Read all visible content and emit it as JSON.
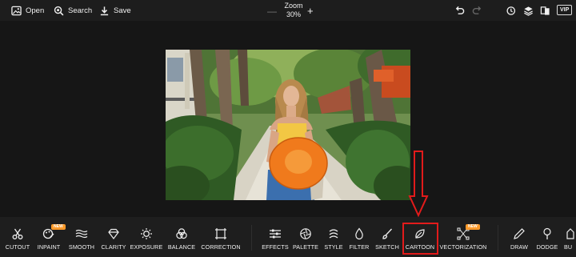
{
  "toolbar": {
    "open_label": "Open",
    "search_label": "Search",
    "save_label": "Save",
    "zoom_title": "Zoom",
    "zoom_value": "30%",
    "zoom_minus": "—",
    "zoom_plus": "+",
    "vip_label": "VIP",
    "icons": [
      "undo-icon",
      "redo-icon",
      "history-icon",
      "layers-icon",
      "compare-icon"
    ]
  },
  "tools_left": [
    {
      "label": "CUTOUT",
      "icon": "scissors-icon"
    },
    {
      "label": "INPAINT",
      "icon": "inpaint-icon",
      "badge": "NEW"
    },
    {
      "label": "SMOOTH",
      "icon": "waves-icon"
    },
    {
      "label": "CLARITY",
      "icon": "diamond-icon"
    },
    {
      "label": "EXPOSURE",
      "icon": "sun-icon"
    },
    {
      "label": "BALANCE",
      "icon": "circles-icon"
    },
    {
      "label": "CORRECTION",
      "icon": "crop-icon"
    }
  ],
  "tools_middle": [
    {
      "label": "EFFECTS",
      "icon": "sliders-icon"
    },
    {
      "label": "PALETTE",
      "icon": "aperture-icon"
    },
    {
      "label": "STYLE",
      "icon": "style-icon"
    },
    {
      "label": "FILTER",
      "icon": "drop-icon"
    },
    {
      "label": "SKETCH",
      "icon": "brush-icon"
    },
    {
      "label": "CARTOON",
      "icon": "leaf-icon"
    },
    {
      "label": "VECTORIZATION",
      "icon": "vector-icon",
      "badge": "NEW"
    }
  ],
  "tools_right": [
    {
      "label": "DRAW",
      "icon": "pencil-icon"
    },
    {
      "label": "DODGE",
      "icon": "dodge-icon"
    },
    {
      "label": "BU",
      "icon": "burn-icon"
    }
  ],
  "colors": {
    "background": "#161616",
    "toolbar": "#1d1d1d",
    "highlight": "#e21b1b",
    "badge": "#ff9a2a"
  }
}
